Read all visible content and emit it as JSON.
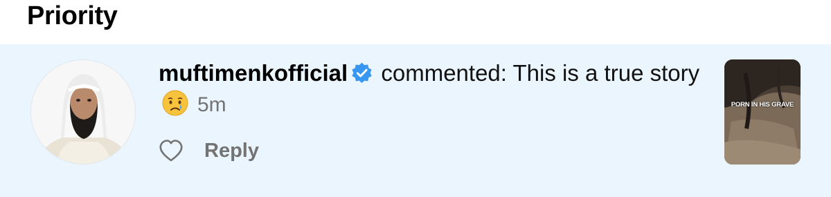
{
  "section": {
    "title": "Priority"
  },
  "notification": {
    "username": "muftimenkofficial",
    "verified": true,
    "action_text": "commented: This is a true story",
    "emoji": "crying-face",
    "time": "5m",
    "reply_label": "Reply",
    "like_icon": "heart-outline-icon",
    "thumbnail_caption": "PORN IN HIS GRAVE"
  },
  "colors": {
    "row_background": "#eaf5fd",
    "verified_blue": "#3897f0",
    "muted_gray": "#737373"
  }
}
